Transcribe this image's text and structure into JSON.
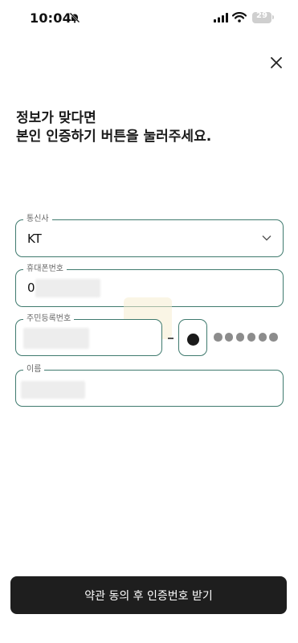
{
  "status_bar": {
    "time": "10:04",
    "battery": "29"
  },
  "heading": {
    "line1": "정보가 맞다면",
    "line2": "본인 인증하기 버튼을 눌러주세요."
  },
  "form": {
    "carrier": {
      "label": "통신사",
      "value": "KT"
    },
    "phone": {
      "label": "휴대폰번호",
      "value_prefix": "0"
    },
    "resident_number": {
      "label": "주민등록번호"
    },
    "name": {
      "label": "이름"
    }
  },
  "cta": {
    "label": "약관 동의 후 인증번호 받기"
  },
  "icons": {
    "silent": "bell-slash-icon",
    "signal": "cellular-signal-icon",
    "wifi": "wifi-icon",
    "battery": "battery-icon",
    "close": "close-icon",
    "dropdown": "chevron-down-icon"
  },
  "colors": {
    "field_border": "#3f7a6e",
    "cta_background": "#1e1e1e"
  }
}
